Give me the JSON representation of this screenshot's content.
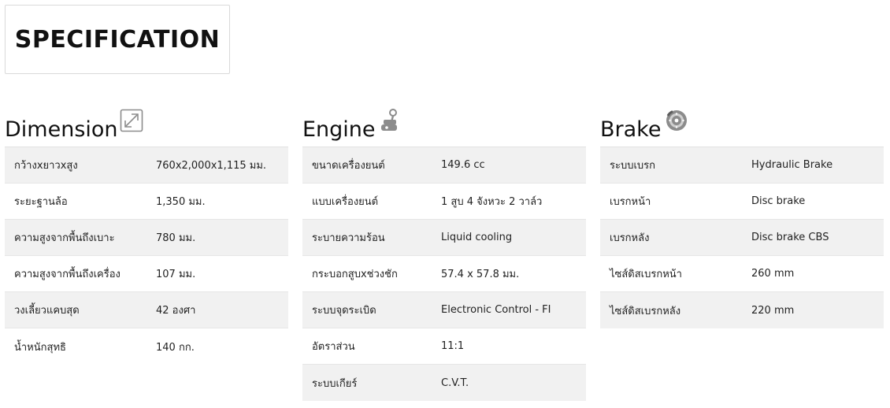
{
  "header": {
    "title": "SPECIFICATION"
  },
  "sections": [
    {
      "title": "Dimension",
      "icon": "expand-arrows-icon",
      "rows": [
        {
          "label": "กว้างxยาวxสูง",
          "value": "760x2,000x1,115 มม."
        },
        {
          "label": "ระยะฐานล้อ",
          "value": "1,350 มม."
        },
        {
          "label": "ความสูงจากพื้นถึงเบาะ",
          "value": "780 มม."
        },
        {
          "label": "ความสูงจากพื้นถึงเครื่อง",
          "value": "107 มม."
        },
        {
          "label": "วงเลี้ยวแคบสุด",
          "value": "42 องศา"
        },
        {
          "label": "น้ำหนักสุทธิ",
          "value": "140 กก."
        }
      ]
    },
    {
      "title": "Engine",
      "icon": "piston-icon",
      "rows": [
        {
          "label": "ขนาดเครื่องยนต์",
          "value": "149.6 cc"
        },
        {
          "label": "แบบเครื่องยนต์",
          "value": "1 สูบ 4 จังหวะ 2 วาล์ว"
        },
        {
          "label": "ระบายความร้อน",
          "value": "Liquid cooling"
        },
        {
          "label": "กระบอกสูบxช่วงชัก",
          "value": "57.4 x 57.8 มม."
        },
        {
          "label": "ระบบจุดระเบิด",
          "value": "Electronic Control - FI"
        },
        {
          "label": "อัตราส่วน",
          "value": "11:1"
        },
        {
          "label": "ระบบเกียร์",
          "value": "C.V.T."
        }
      ]
    },
    {
      "title": "Brake",
      "icon": "brake-disc-icon",
      "rows": [
        {
          "label": "ระบบเบรก",
          "value": "Hydraulic Brake"
        },
        {
          "label": "เบรกหน้า",
          "value": "Disc brake"
        },
        {
          "label": "เบรกหลัง",
          "value": "Disc brake CBS"
        },
        {
          "label": "ไซส์ดิสเบรกหน้า",
          "value": "260 mm"
        },
        {
          "label": "ไซส์ดิสเบรกหลัง",
          "value": "220 mm"
        }
      ]
    }
  ]
}
